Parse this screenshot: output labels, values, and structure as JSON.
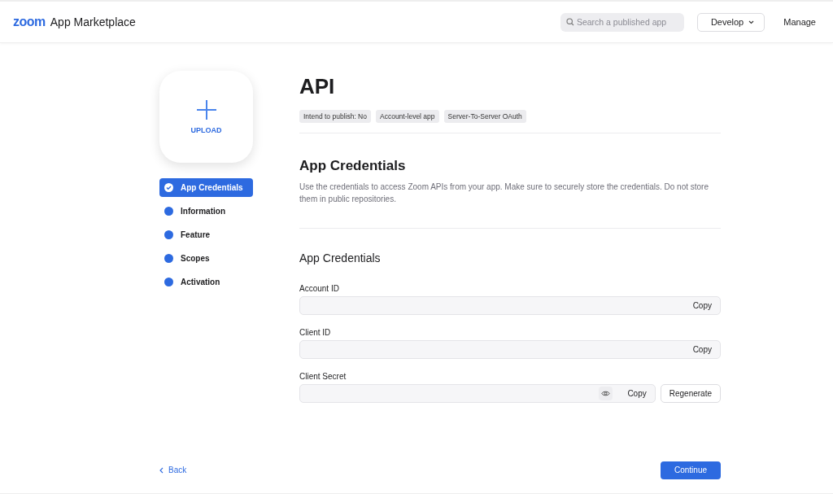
{
  "header": {
    "logo": "zoom",
    "title": "App Marketplace",
    "search": {
      "placeholder": "Search a published app"
    },
    "develop": "Develop",
    "manage": "Manage"
  },
  "upload": {
    "label": "UPLOAD"
  },
  "sidebar": {
    "items": [
      {
        "label": "App Credentials",
        "selected": true
      },
      {
        "label": "Information",
        "selected": false
      },
      {
        "label": "Feature",
        "selected": false
      },
      {
        "label": "Scopes",
        "selected": false
      },
      {
        "label": "Activation",
        "selected": false
      }
    ]
  },
  "app": {
    "title": "API",
    "tags": [
      "Intend to publish: No",
      "Account-level app",
      "Server-To-Server OAuth"
    ]
  },
  "section": {
    "title": "App Credentials",
    "description": "Use the credentials to access Zoom APIs from your app. Make sure to securely store the credentials. Do not store them in public repositories."
  },
  "credentials": {
    "title": "App Credentials",
    "fields": [
      {
        "kind": "plain",
        "label": "Account ID",
        "copy": "Copy"
      },
      {
        "kind": "plain",
        "label": "Client ID",
        "copy": "Copy"
      },
      {
        "kind": "secret",
        "label": "Client Secret",
        "copy": "Copy",
        "regenerate": "Regenerate"
      }
    ]
  },
  "footer": {
    "back": "Back",
    "continue": "Continue"
  }
}
